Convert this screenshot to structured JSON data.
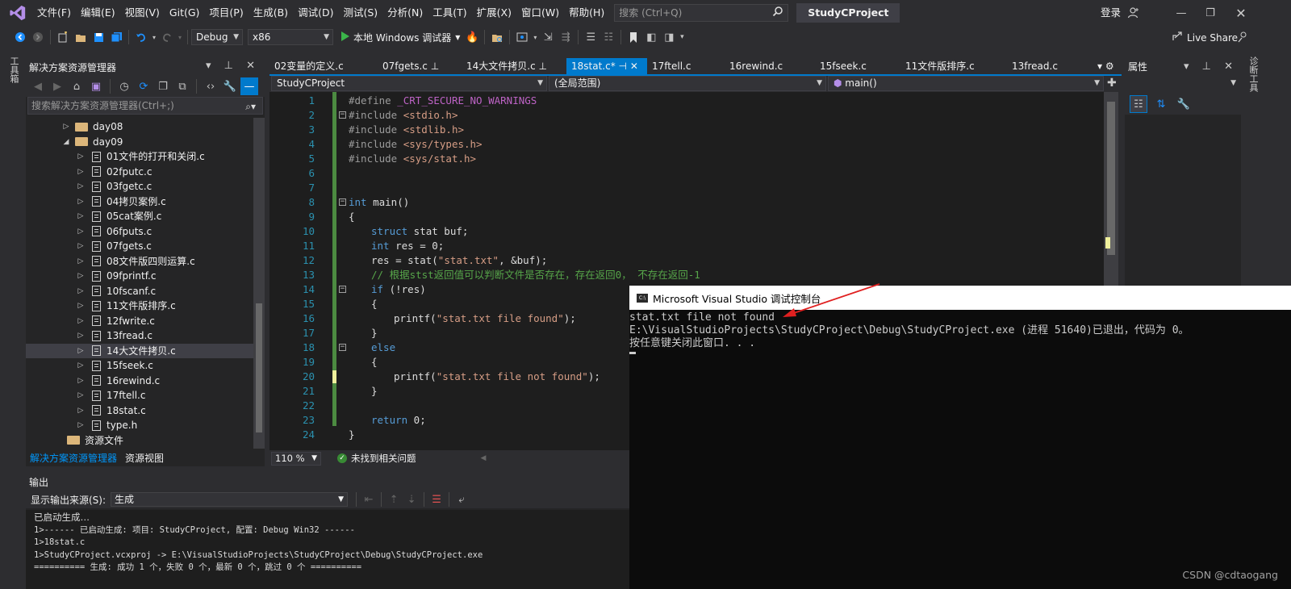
{
  "menubar": {
    "items": [
      "文件(F)",
      "编辑(E)",
      "视图(V)",
      "Git(G)",
      "项目(P)",
      "生成(B)",
      "调试(D)",
      "测试(S)",
      "分析(N)",
      "工具(T)",
      "扩展(X)",
      "窗口(W)",
      "帮助(H)"
    ],
    "search_placeholder": "搜索 (Ctrl+Q)",
    "solution_name": "StudyCProject",
    "login": "登录"
  },
  "toolbar": {
    "config": "Debug",
    "platform": "x86",
    "run_label": "本地 Windows 调试器",
    "live_share": "Live Share"
  },
  "left_strip": {
    "label": "工具箱"
  },
  "right_strip": {
    "label": "诊断工具"
  },
  "solution_explorer": {
    "title": "解决方案资源管理器",
    "search_placeholder": "搜索解决方案资源管理器(Ctrl+;)",
    "folders": {
      "day08": "day08",
      "day09": "day09",
      "resources": "资源文件"
    },
    "files": [
      "01文件的打开和关闭.c",
      "02fputc.c",
      "03fgetc.c",
      "04拷贝案例.c",
      "05cat案例.c",
      "06fputs.c",
      "07fgets.c",
      "08文件版四则运算.c",
      "09fprintf.c",
      "10fscanf.c",
      "11文件版排序.c",
      "12fwrite.c",
      "13fread.c",
      "14大文件拷贝.c",
      "15fseek.c",
      "16rewind.c",
      "17ftell.c",
      "18stat.c",
      "type.h"
    ],
    "tabs": [
      "解决方案资源管理器",
      "资源视图"
    ]
  },
  "editor": {
    "tabs": [
      "02变量的定义.c",
      "07fgets.c",
      "14大文件拷贝.c",
      "18stat.c*",
      "17ftell.c",
      "16rewind.c",
      "15fseek.c",
      "11文件版排序.c",
      "13fread.c"
    ],
    "nav": {
      "project": "StudyCProject",
      "scope": "(全局范围)",
      "member": "main()"
    },
    "line_numbers": [
      "1",
      "2",
      "3",
      "4",
      "5",
      "6",
      "7",
      "8",
      "9",
      "10",
      "11",
      "12",
      "13",
      "14",
      "15",
      "16",
      "17",
      "18",
      "19",
      "20",
      "21",
      "22",
      "23",
      "24"
    ],
    "code": {
      "l1_kw": "#define ",
      "l1_macro": "_CRT_SECURE_NO_WARNINGS",
      "l2_kw": "#include ",
      "l2_inc": "<stdio.h>",
      "l3_kw": "#include ",
      "l3_inc": "<stdlib.h>",
      "l4_kw": "#include ",
      "l4_inc": "<sys/types.h>",
      "l5_kw": "#include ",
      "l5_inc": "<sys/stat.h>",
      "l8_kw": "int",
      "l8_rest": " main()",
      "l9": "{",
      "l10_kw": "struct",
      "l10_rest": " stat buf;",
      "l11_kw": "int",
      "l11_rest": " res = 0;",
      "l12_a": "res = stat(",
      "l12_str": "\"stat.txt\"",
      "l12_b": ", &buf);",
      "l13_cm": "// 根据stst返回值可以判断文件是否存在，存在返回0， 不存在返回-1",
      "l14_kw": "if",
      "l14_rest": " (!res)",
      "l15": "{",
      "l16_a": "printf(",
      "l16_str": "\"stat.txt file found\"",
      "l16_b": ");",
      "l17": "}",
      "l18_kw": "else",
      "l19": "{",
      "l20_a": "printf(",
      "l20_str": "\"stat.txt file not found\"",
      "l20_b": ");",
      "l21": "}",
      "l23_kw": "return",
      "l23_rest": " 0;",
      "l24": "}"
    },
    "zoom": "110 %",
    "issues": "未找到相关问题"
  },
  "properties": {
    "title": "属性"
  },
  "output": {
    "title": "输出",
    "source_label": "显示输出来源(S):",
    "source_value": "生成",
    "lines": [
      "已启动生成…",
      "1>------ 已启动生成: 项目: StudyCProject, 配置: Debug Win32 ------",
      "1>18stat.c",
      "1>StudyCProject.vcxproj -> E:\\VisualStudioProjects\\StudyCProject\\Debug\\StudyCProject.exe",
      "========== 生成: 成功 1 个，失败 0 个，最新 0 个，跳过 0 个 =========="
    ]
  },
  "console": {
    "title": "Microsoft Visual Studio 调试控制台",
    "icon_text": "C:\\",
    "lines": [
      "stat.txt file not found",
      "E:\\VisualStudioProjects\\StudyCProject\\Debug\\StudyCProject.exe (进程 51640)已退出，代码为 0。",
      "按任意键关闭此窗口. . ."
    ]
  },
  "watermark": "CSDN @cdtaogang",
  "colors": {
    "accent": "#007acc",
    "keyword": "#569cd6",
    "string": "#d69d85",
    "comment": "#57a64a",
    "line_number": "#2b91af"
  }
}
